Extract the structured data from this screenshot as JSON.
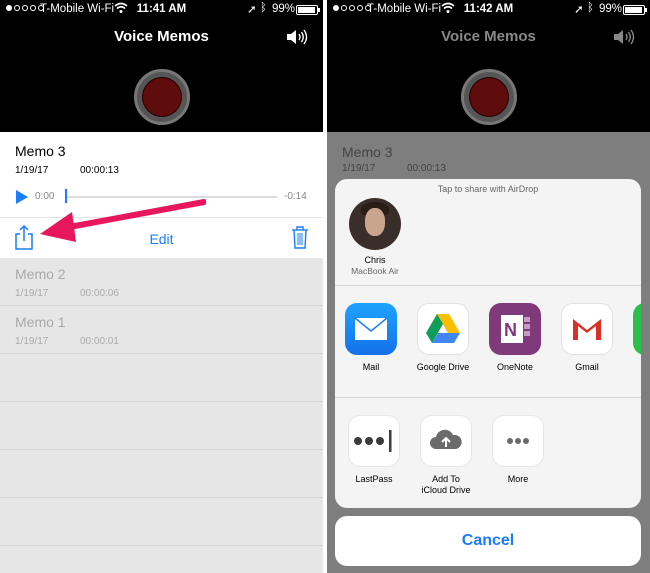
{
  "status_left": {
    "carrier": "T-Mobile Wi-Fi",
    "time": "11:41 AM",
    "battery": "99%"
  },
  "status_right": {
    "carrier": "T-Mobile Wi-Fi",
    "time": "11:42 AM",
    "battery": "99%"
  },
  "app": {
    "title": "Voice Memos"
  },
  "active_memo": {
    "name": "Memo 3",
    "date": "1/19/17",
    "duration": "00:00:13",
    "elapsed": "0:00",
    "remaining": "-0:14",
    "progress": 0.0,
    "edit_label": "Edit"
  },
  "memos": [
    {
      "name": "Memo 2",
      "date": "1/19/17",
      "duration": "00:00:06"
    },
    {
      "name": "Memo 1",
      "date": "1/19/17",
      "duration": "00:00:01"
    }
  ],
  "share_sheet": {
    "airdrop_hint": "Tap to share with AirDrop",
    "contact": {
      "name": "Chris",
      "device": "MacBook Air"
    },
    "apps": [
      {
        "label": "Mail",
        "icon": "mail-icon"
      },
      {
        "label": "Google Drive",
        "icon": "google-drive-icon"
      },
      {
        "label": "OneNote",
        "icon": "onenote-icon"
      },
      {
        "label": "Gmail",
        "icon": "gmail-icon"
      }
    ],
    "actions": [
      {
        "label": "LastPass",
        "icon": "lastpass-icon"
      },
      {
        "label": "Add To\niCloud Drive",
        "icon": "icloud-upload-icon"
      },
      {
        "label": "More",
        "icon": "more-icon"
      }
    ],
    "cancel_label": "Cancel"
  },
  "colors": {
    "accent": "#1a7cff",
    "arrow": "#e8175d",
    "record": "#5e0c0c"
  }
}
